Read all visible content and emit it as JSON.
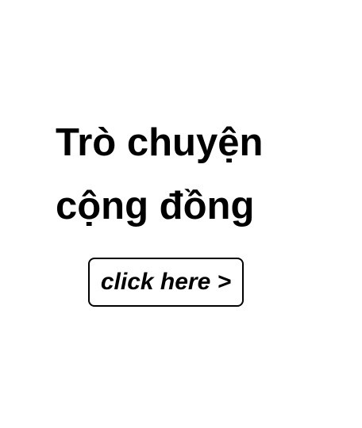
{
  "headline": {
    "line1": "Trò chuyện",
    "line2": "cộng đồng"
  },
  "cta": {
    "label": "click here >"
  },
  "colors": {
    "background": "#ffffff",
    "text": "#000000",
    "button_border": "#000000"
  }
}
